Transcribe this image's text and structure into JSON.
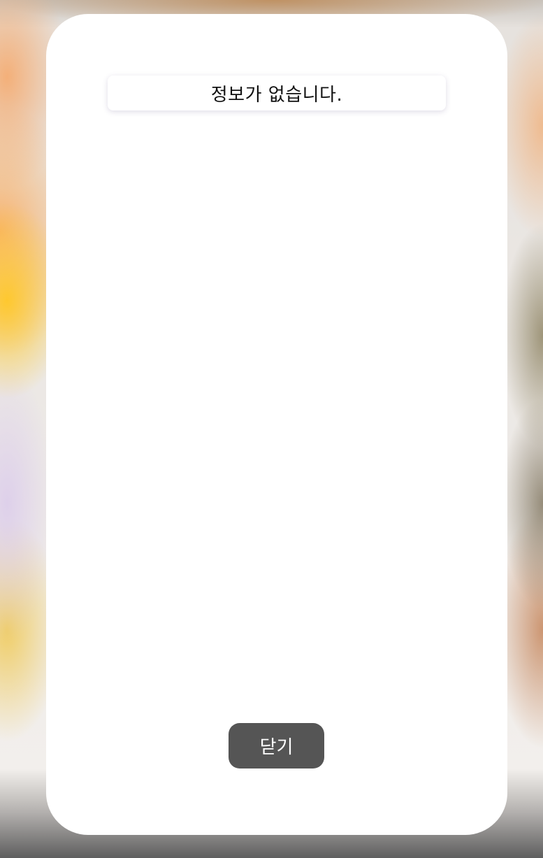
{
  "dialog": {
    "message": "정보가 없습니다.",
    "close_label": "닫기"
  },
  "colors": {
    "close_button_bg": "#555555",
    "close_button_text": "#ffffff",
    "modal_bg": "#ffffff"
  }
}
